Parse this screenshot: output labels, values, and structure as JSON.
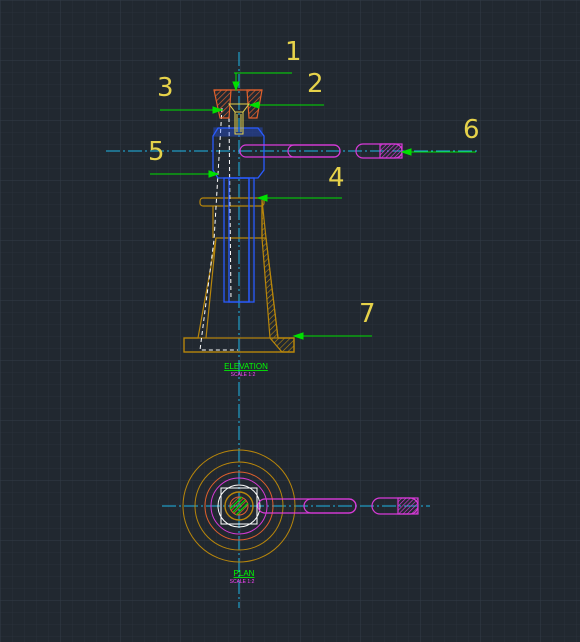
{
  "colors": {
    "background": "#212830",
    "grid_minor": "#2a323b",
    "grid_major": "#323b45",
    "centerline": "#20b6e6",
    "leader": "#00e000",
    "callout_text": "#e6d24a",
    "screw": "#2a5bff",
    "body": "#b8860b",
    "cap_cup": "#e0602c",
    "handle": "#d83ad8",
    "hidden_line": "#ffffff",
    "caption": "#00ff00",
    "scale_text": "#ff44ff"
  },
  "callouts": [
    {
      "id": "1",
      "text": "1"
    },
    {
      "id": "2",
      "text": "2"
    },
    {
      "id": "3",
      "text": "3"
    },
    {
      "id": "4",
      "text": "4"
    },
    {
      "id": "5",
      "text": "5"
    },
    {
      "id": "6",
      "text": "6"
    },
    {
      "id": "7",
      "text": "7"
    }
  ],
  "views": {
    "elevation": {
      "title": "ELEVATION",
      "scale": "SCALE 1:2"
    },
    "plan": {
      "title": "PLAN",
      "scale": "SCALE 1:2"
    }
  },
  "icons": [
    "crosshair-icon"
  ]
}
